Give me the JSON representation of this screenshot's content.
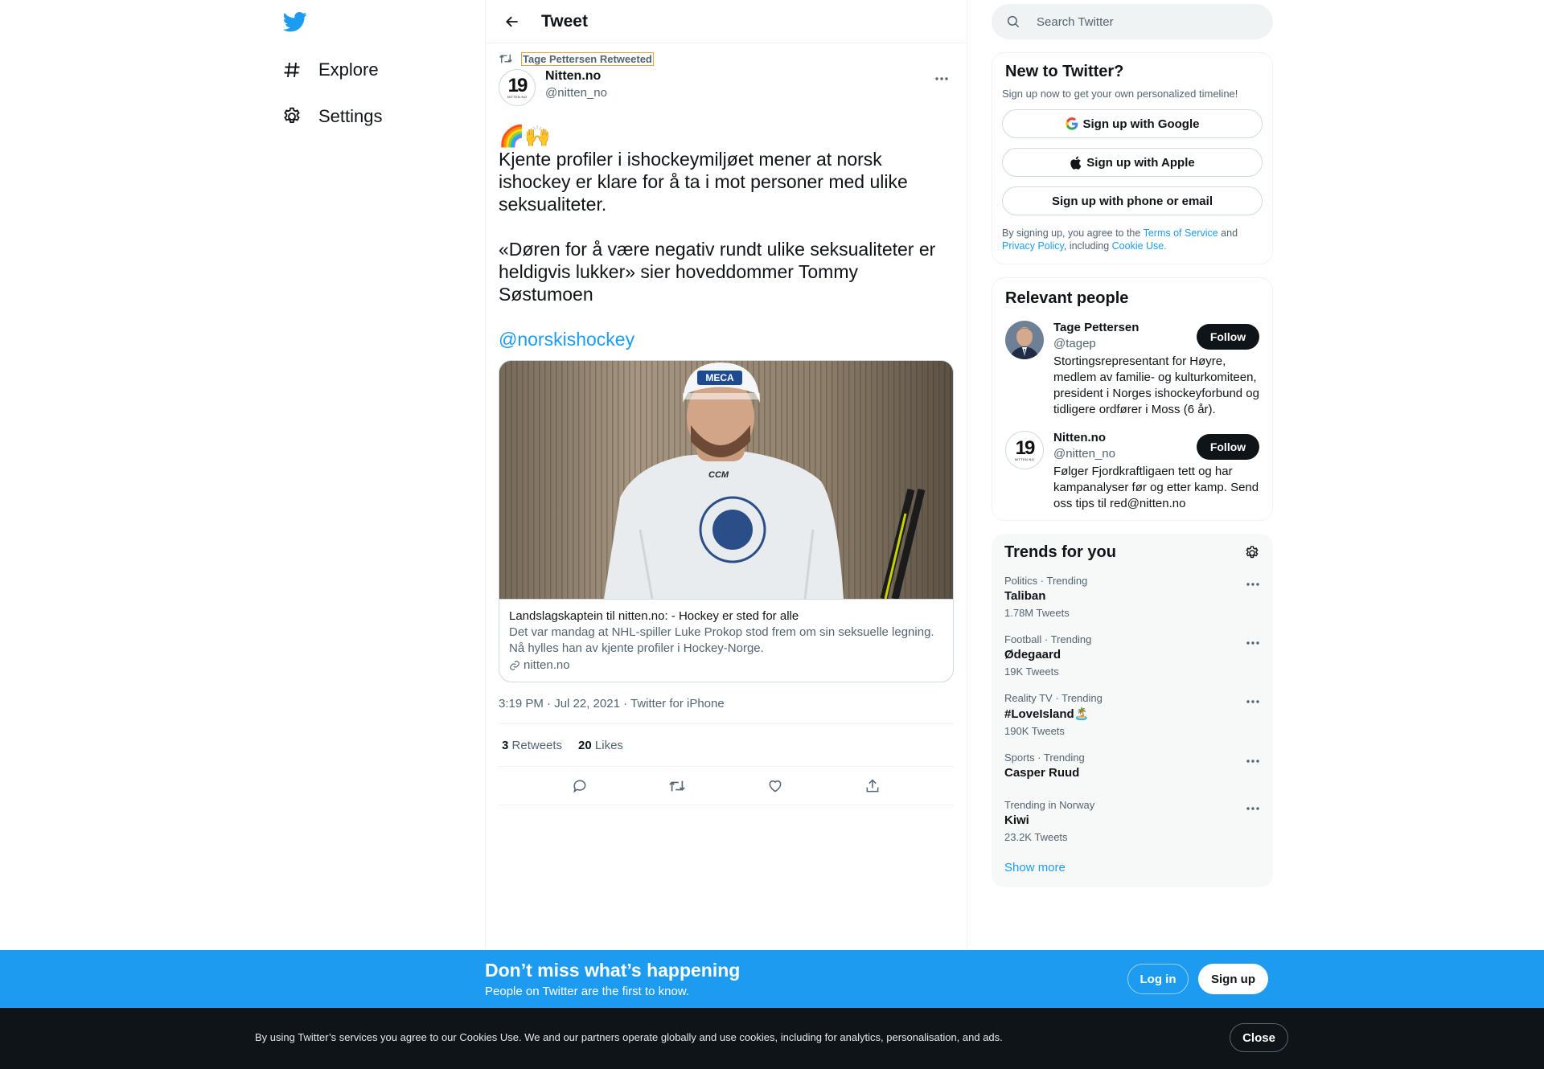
{
  "colors": {
    "accent": "#1d9bf0",
    "text": "#0f1419",
    "muted": "#536471",
    "highlight_border": "#e9a23b"
  },
  "nav": {
    "logo_icon": "twitter-bird-icon",
    "items": [
      {
        "label": "Explore",
        "icon": "hashtag-icon"
      },
      {
        "label": "Settings",
        "icon": "gear-icon"
      }
    ]
  },
  "header": {
    "title": "Tweet",
    "back_icon": "back-arrow-icon"
  },
  "tweet": {
    "retweeted_by": "Tage Pettersen Retweeted",
    "author_name": "Nitten.no",
    "author_handle": "@nitten_no",
    "avatar_text": "19",
    "avatar_subtext": "NITTEN.NO",
    "emoji": "🌈🙌",
    "body": "Kjente profiler i ishockeymiljøet mener at norsk ishockey er klare for å ta i mot personer med ulike seksualiteter.\n\n«Døren for å være negativ rundt ulike seksualiteter er heldigvis lukker» sier hoveddommer Tommy Søstumoen",
    "mention": "@norskishockey",
    "card": {
      "helmet_logo": "MECA",
      "jersey_brand": "CCM",
      "jersey_crest": "NORGES ISHOCKEYFORBUND 1934",
      "title": "Landslagskaptein til nitten.no: - Hockey er sted for alle",
      "description": "Det var mandag at NHL-spiller Luke Prokop stod frem om sin seksuelle legning. Nå hylles han av kjente profiler i Hockey-Norge.",
      "domain": "nitten.no"
    },
    "timestamp": "3:19 PM · Jul 22, 2021 · Twitter for iPhone",
    "retweets_count": "3",
    "retweets_label": "Retweets",
    "likes_count": "20",
    "likes_label": "Likes"
  },
  "sidebar": {
    "search_placeholder": "Search Twitter",
    "new_to_twitter": {
      "title": "New to Twitter?",
      "subtitle": "Sign up now to get your own personalized timeline!",
      "google": "Sign up with Google",
      "apple": "Sign up with Apple",
      "phone": "Sign up with phone or email",
      "terms_1": "By signing up, you agree to the ",
      "terms_link_1": "Terms of Service",
      "terms_2": " and ",
      "terms_link_2": "Privacy Policy",
      "terms_3": ", including ",
      "terms_link_3": "Cookie Use."
    },
    "relevant": {
      "title": "Relevant people",
      "people": [
        {
          "name": "Tage Pettersen",
          "handle": "@tagep",
          "bio": "Stortingsrepresentant for Høyre, medlem av familie- og kulturkomiteen, president i Norges ishockeyforbund og tidligere ordfører i Moss (6 år).",
          "follow": "Follow"
        },
        {
          "name": "Nitten.no",
          "handle": "@nitten_no",
          "bio": "Følger Fjordkraftligaen tett og har kampanalyser før og etter kamp. Send oss tips til red@nitten.no",
          "follow": "Follow"
        }
      ]
    },
    "trends": {
      "title": "Trends for you",
      "items": [
        {
          "context": "Politics · Trending",
          "name": "Taliban",
          "count": "1.78M Tweets"
        },
        {
          "context": "Football · Trending",
          "name": "Ødegaard",
          "count": "19K Tweets"
        },
        {
          "context": "Reality TV · Trending",
          "name": "#LoveIsland🏝️",
          "count": "190K Tweets"
        },
        {
          "context": "Sports · Trending",
          "name": "Casper Ruud",
          "count": ""
        },
        {
          "context": "Trending in Norway",
          "name": "Kiwi",
          "count": "23.2K Tweets"
        }
      ],
      "show_more": "Show more"
    }
  },
  "promo": {
    "title": "Don’t miss what’s happening",
    "subtitle": "People on Twitter are the first to know.",
    "login": "Log in",
    "signup": "Sign up"
  },
  "cookie": {
    "text": "By using Twitter’s services you agree to our Cookies Use. We and our partners operate globally and use cookies, including for analytics, personalisation, and ads.",
    "close": "Close"
  }
}
